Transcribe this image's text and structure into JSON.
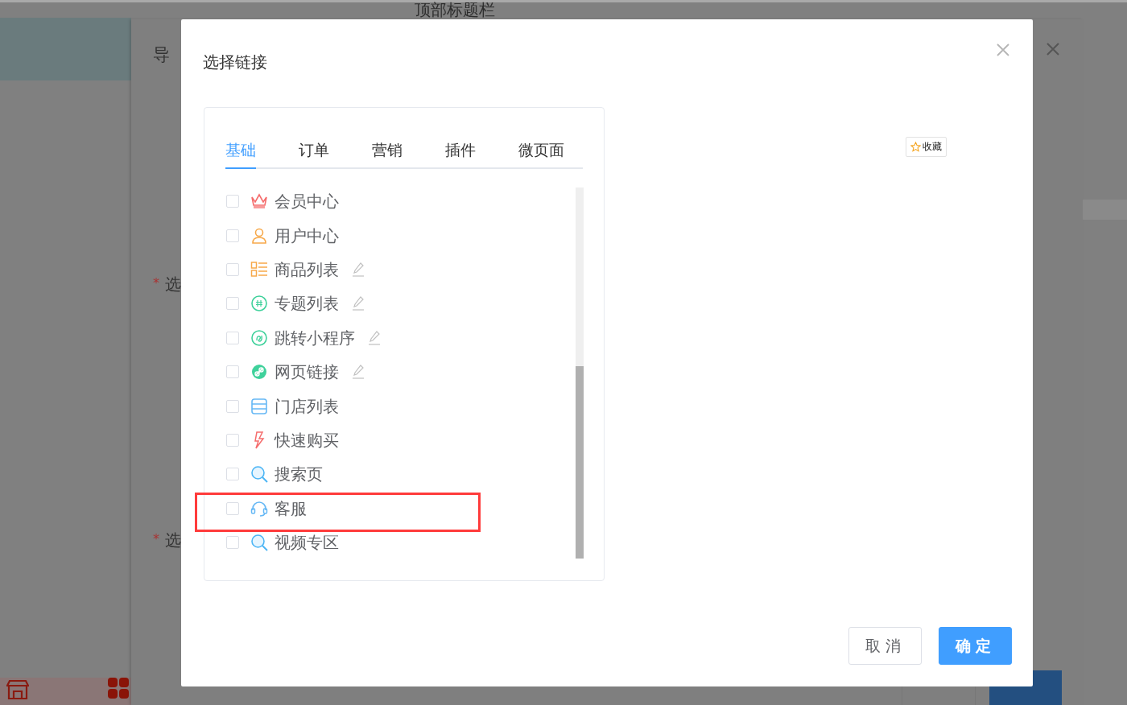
{
  "background": {
    "header_title": "顶部标题栏",
    "dialog": {
      "title": "导",
      "fields": [
        {
          "mark": "*",
          "label": "选"
        },
        {
          "mark": "*",
          "label": "选"
        }
      ]
    }
  },
  "dialog": {
    "title": "选择链接",
    "tabs": [
      {
        "label": "基础",
        "selected": true
      },
      {
        "label": "订单",
        "selected": false
      },
      {
        "label": "营销",
        "selected": false
      },
      {
        "label": "插件",
        "selected": false
      },
      {
        "label": "微页面",
        "selected": false
      }
    ],
    "items": [
      {
        "label": "会员中心",
        "kind": "crown",
        "editable": false,
        "checked": false
      },
      {
        "label": "用户中心",
        "kind": "user",
        "editable": false,
        "checked": false
      },
      {
        "label": "商品列表",
        "kind": "list",
        "editable": true,
        "checked": false
      },
      {
        "label": "专题列表",
        "kind": "topic",
        "editable": true,
        "checked": false
      },
      {
        "label": "跳转小程序",
        "kind": "miniapp",
        "editable": true,
        "checked": false
      },
      {
        "label": "网页链接",
        "kind": "link",
        "editable": true,
        "checked": false
      },
      {
        "label": "门店列表",
        "kind": "store",
        "editable": false,
        "checked": false
      },
      {
        "label": "快速购买",
        "kind": "bolt",
        "editable": false,
        "checked": false
      },
      {
        "label": "搜索页",
        "kind": "search",
        "editable": false,
        "checked": false
      },
      {
        "label": "客服",
        "kind": "headset",
        "editable": false,
        "checked": false
      },
      {
        "label": "视频专区",
        "kind": "search",
        "editable": false,
        "checked": false
      }
    ],
    "favorite": "收藏",
    "buttons": [
      {
        "label": "取消",
        "kind": "default"
      },
      {
        "label": "确定",
        "kind": "primary"
      }
    ]
  }
}
